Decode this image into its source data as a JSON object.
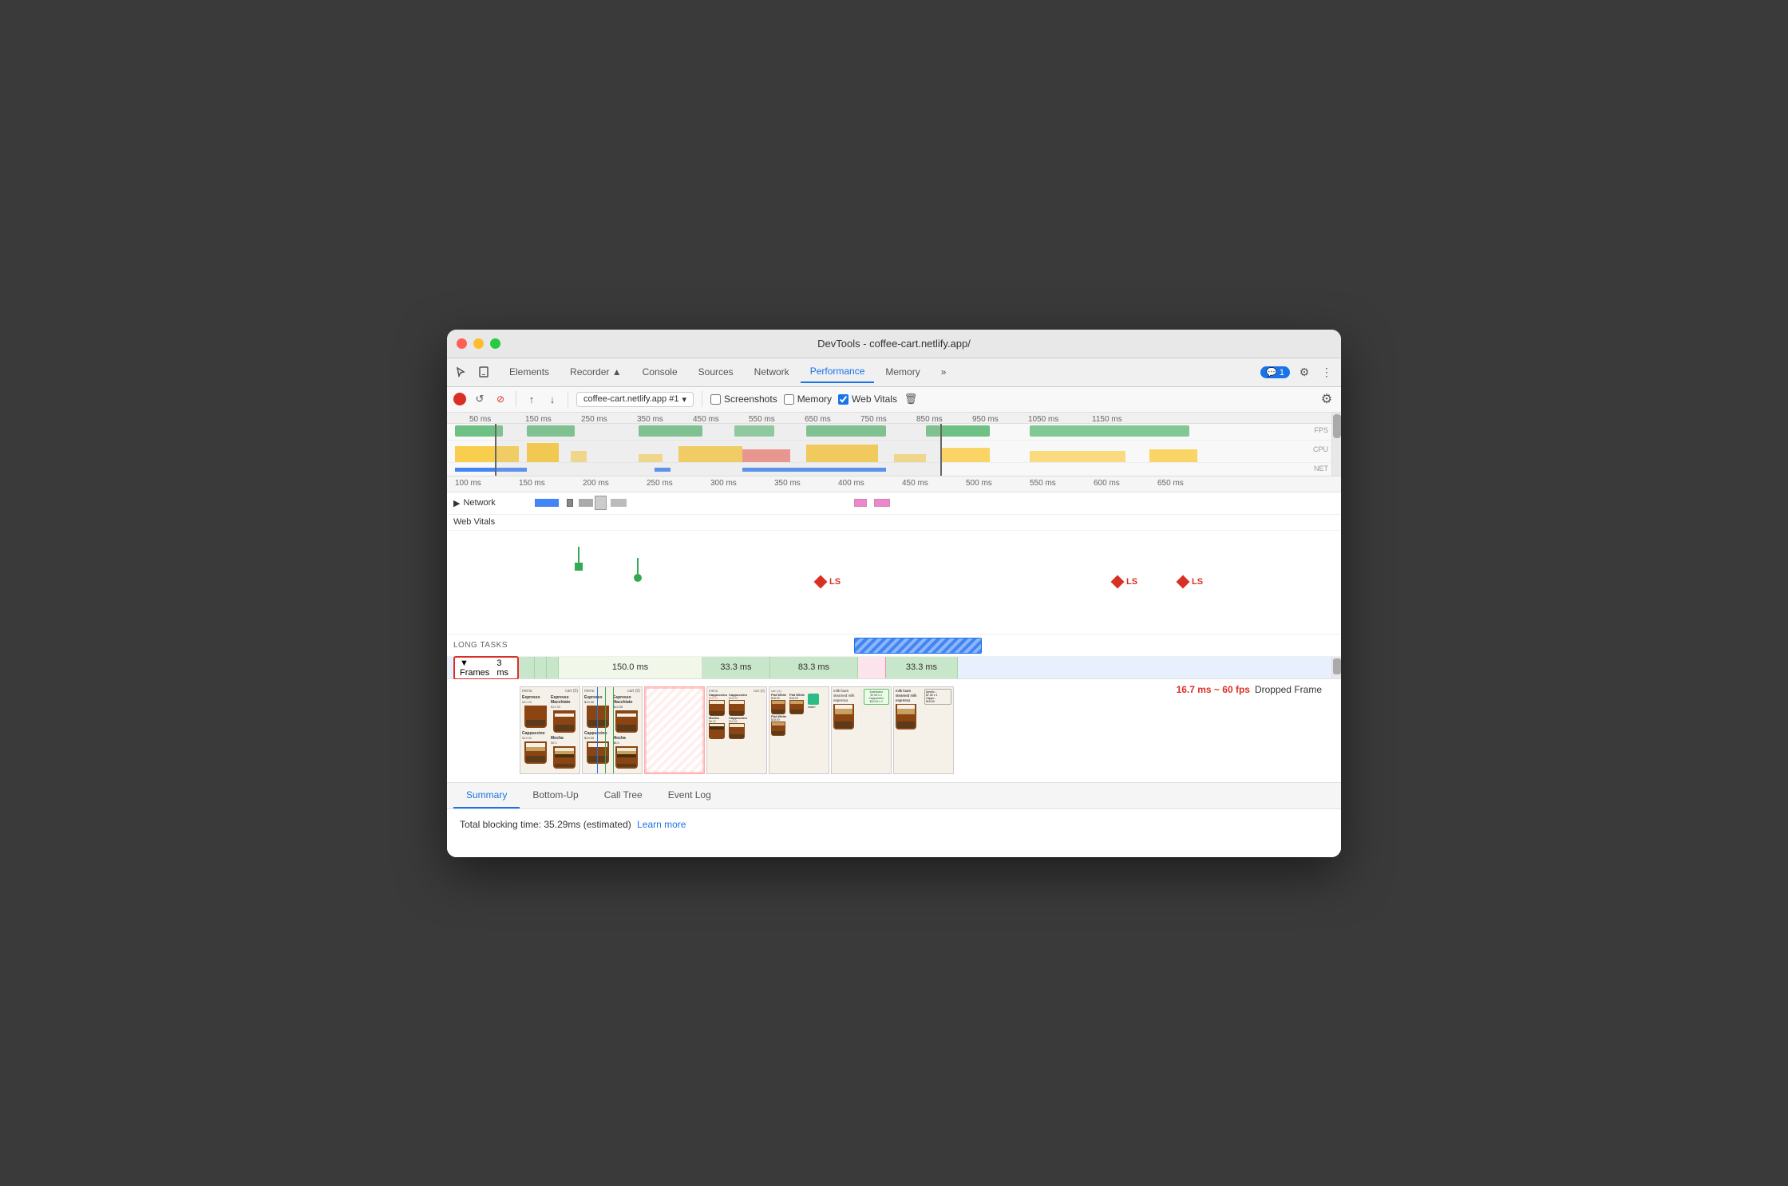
{
  "window": {
    "title": "DevTools - coffee-cart.netlify.app/"
  },
  "traffic_lights": {
    "close_label": "close",
    "minimize_label": "minimize",
    "maximize_label": "maximize"
  },
  "nav": {
    "tabs": [
      {
        "id": "elements",
        "label": "Elements",
        "active": false
      },
      {
        "id": "recorder",
        "label": "Recorder ▲",
        "active": false
      },
      {
        "id": "console",
        "label": "Console",
        "active": false
      },
      {
        "id": "sources",
        "label": "Sources",
        "active": false
      },
      {
        "id": "network",
        "label": "Network",
        "active": false
      },
      {
        "id": "performance",
        "label": "Performance",
        "active": true
      },
      {
        "id": "memory",
        "label": "Memory",
        "active": false
      },
      {
        "id": "more",
        "label": "»",
        "active": false
      }
    ],
    "badge_count": "1"
  },
  "toolbar": {
    "record_tooltip": "Record",
    "reload_tooltip": "Reload",
    "clear_tooltip": "Clear",
    "upload_tooltip": "Upload",
    "download_tooltip": "Download",
    "target_selector": "coffee-cart.netlify.app #1",
    "screenshots_label": "Screenshots",
    "memory_label": "Memory",
    "web_vitals_label": "Web Vitals",
    "delete_tooltip": "Delete",
    "settings_tooltip": "Settings"
  },
  "timeline": {
    "overview": {
      "time_marks": [
        "50 ms",
        "150 ms",
        "250 ms",
        "350 ms",
        "450 ms",
        "550 ms",
        "650 ms",
        "750 ms",
        "850 ms",
        "950 ms",
        "1050 ms",
        "1150 ms"
      ],
      "fps_label": "FPS",
      "cpu_label": "CPU",
      "net_label": "NET"
    },
    "main": {
      "time_marks": [
        "100 ms",
        "150 ms",
        "200 ms",
        "250 ms",
        "300 ms",
        "350 ms",
        "400 ms",
        "450 ms",
        "500 ms",
        "550 ms",
        "600 ms",
        "650 ms"
      ],
      "network_label": "Network",
      "web_vitals_label": "Web Vitals",
      "long_tasks_label": "LONG TASKS",
      "frames_label": "▼ Frames",
      "frames_timing": "3 ms",
      "frame_segments": [
        {
          "label": "",
          "width_pct": 3,
          "class": "frame-green"
        },
        {
          "label": "",
          "width_pct": 2,
          "class": "frame-green"
        },
        {
          "label": "",
          "width_pct": 2,
          "class": "frame-green"
        },
        {
          "label": "150.0 ms",
          "width_pct": 20,
          "class": "frame-light-green"
        },
        {
          "label": "33.3 ms",
          "width_pct": 10,
          "class": "frame-green"
        },
        {
          "label": "83.3 ms",
          "width_pct": 12,
          "class": "frame-green"
        },
        {
          "label": "",
          "width_pct": 4,
          "class": "frame-pink"
        },
        {
          "label": "33.3 ms",
          "width_pct": 10,
          "class": "frame-green"
        }
      ]
    }
  },
  "dropped_frame": {
    "timing": "16.7 ms ~ 60 fps",
    "label": "Dropped Frame"
  },
  "bottom_panel": {
    "tabs": [
      {
        "id": "summary",
        "label": "Summary",
        "active": true
      },
      {
        "id": "bottom-up",
        "label": "Bottom-Up",
        "active": false
      },
      {
        "id": "call-tree",
        "label": "Call Tree",
        "active": false
      },
      {
        "id": "event-log",
        "label": "Event Log",
        "active": false
      }
    ],
    "summary_text": "Total blocking time: 35.29ms (estimated)",
    "learn_more_label": "Learn more",
    "learn_more_url": "#"
  },
  "ls_markers": [
    {
      "label": "LS",
      "position_pct": 50
    },
    {
      "label": "LS",
      "position_pct": 87
    },
    {
      "label": "LS",
      "position_pct": 94
    }
  ]
}
